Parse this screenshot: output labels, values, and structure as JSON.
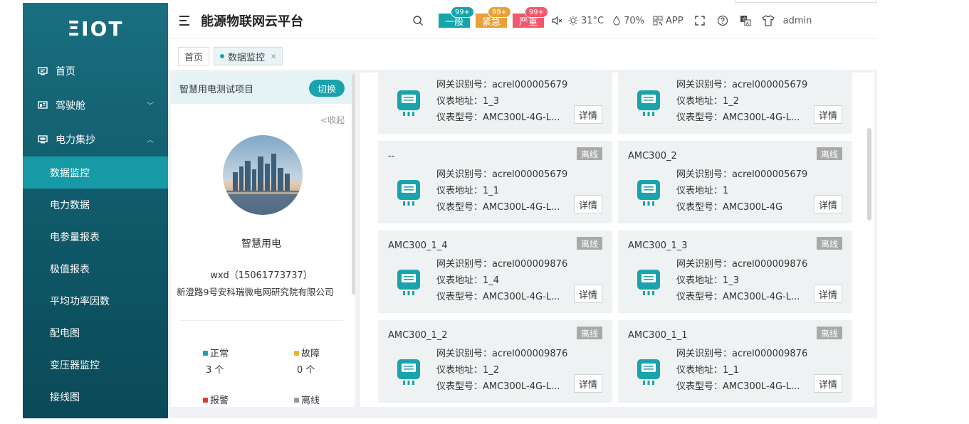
{
  "logo": "ΞIOT",
  "app_title": "能源物联网云平台",
  "sidebar": {
    "top_items": [
      {
        "label": "首页"
      },
      {
        "label": "驾驶舱"
      },
      {
        "label": "电力集抄"
      }
    ],
    "sub_items": [
      {
        "label": "数据监控",
        "active": true
      },
      {
        "label": "电力数据"
      },
      {
        "label": "电参量报表"
      },
      {
        "label": "极值报表"
      },
      {
        "label": "平均功率因数"
      },
      {
        "label": "配电图"
      },
      {
        "label": "变压器监控"
      },
      {
        "label": "接线图"
      }
    ]
  },
  "header": {
    "alarms": [
      {
        "label": "一般",
        "count": "99+",
        "color": "#16a5a9"
      },
      {
        "label": "紧急",
        "count": "99+",
        "color": "#e8a13a"
      },
      {
        "label": "严重",
        "count": "99+",
        "color": "#f0586b"
      }
    ],
    "temperature": "31°C",
    "humidity": "70%",
    "app_label": "APP",
    "user": "admin"
  },
  "tabs": [
    {
      "label": "首页"
    },
    {
      "label": "数据监控",
      "close": "×"
    }
  ],
  "project": {
    "header_title": "智慧用电测试项目",
    "switch_label": "切换",
    "collapse_label": "<收起",
    "name": "智慧用电",
    "user": "wxd（15061773737）",
    "address": "新澄路9号安科瑞微电网研究院有限公司",
    "stats": [
      {
        "label": "正常",
        "value": "3 个",
        "color": "#1aa3ad"
      },
      {
        "label": "故障",
        "value": "0 个",
        "color": "#e8b52b"
      },
      {
        "label": "报警",
        "value": "",
        "color": "#e03b3b"
      },
      {
        "label": "离线",
        "value": "",
        "color": "#999999"
      }
    ]
  },
  "meters": [
    {
      "name": "",
      "status": "",
      "gateway": "网关识别号：acrel000005679",
      "address": "仪表地址：1_3",
      "model": "仪表型号：AMC300L-4G-L...",
      "detail": "详情"
    },
    {
      "name": "",
      "status": "",
      "gateway": "网关识别号：acrel000005679",
      "address": "仪表地址：1_2",
      "model": "仪表型号：AMC300L-4G-L...",
      "detail": "详情"
    },
    {
      "name": "--",
      "status": "离线",
      "gateway": "网关识别号：acrel000005679",
      "address": "仪表地址：1_1",
      "model": "仪表型号：AMC300L-4G-L...",
      "detail": "详情"
    },
    {
      "name": "AMC300_2",
      "status": "离线",
      "gateway": "网关识别号：acrel000005679",
      "address": "仪表地址：1",
      "model": "仪表型号：AMC300L-4G",
      "detail": "详情"
    },
    {
      "name": "AMC300_1_4",
      "status": "离线",
      "gateway": "网关识别号：acrel000009876",
      "address": "仪表地址：1_4",
      "model": "仪表型号：AMC300L-4G-L...",
      "detail": "详情"
    },
    {
      "name": "AMC300_1_3",
      "status": "离线",
      "gateway": "网关识别号：acrel000009876",
      "address": "仪表地址：1_3",
      "model": "仪表型号：AMC300L-4G-L...",
      "detail": "详情"
    },
    {
      "name": "AMC300_1_2",
      "status": "离线",
      "gateway": "网关识别号：acrel000009876",
      "address": "仪表地址：1_2",
      "model": "仪表型号：AMC300L-4G-L...",
      "detail": "详情"
    },
    {
      "name": "AMC300_1_1",
      "status": "离线",
      "gateway": "网关识别号：acrel000009876",
      "address": "仪表地址：1_1",
      "model": "仪表型号：AMC300L-4G-L...",
      "detail": "详情"
    }
  ]
}
